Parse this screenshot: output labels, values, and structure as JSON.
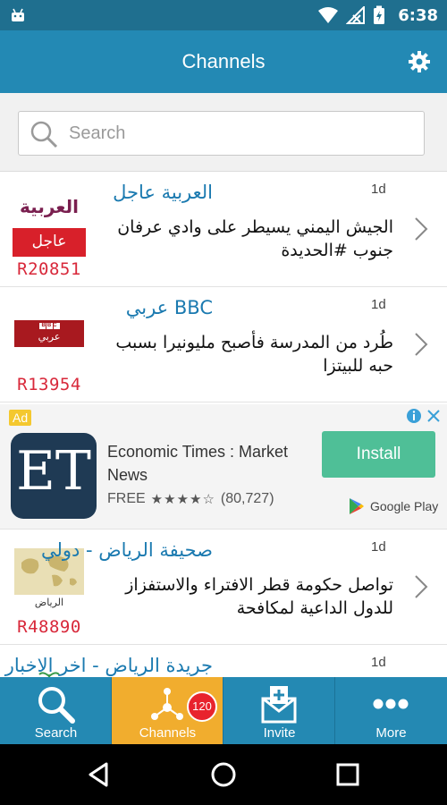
{
  "status_bar": {
    "time": "6:38"
  },
  "app_bar": {
    "title": "Channels",
    "settings_icon": "gear-icon"
  },
  "search": {
    "placeholder": "Search"
  },
  "channels": [
    {
      "name": "العربية عاجل",
      "age": "1d",
      "headline": "الجيش اليمني يسيطر على وادي عرفان جنوب #الحديدة",
      "count": "R20851",
      "logo": {
        "line1": "العربية",
        "line2": "عاجل"
      }
    },
    {
      "name": "BBC عربي",
      "age": "1d",
      "headline": "طُرد من المدرسة فأصبح مليونيرا بسبب حبه للبيتزا",
      "count": "R13954",
      "logo": {
        "line1": "BBC",
        "line2": "عربي"
      }
    },
    {
      "name": "صحيفة الرياض - دولي",
      "age": "1d",
      "headline": "تواصل حكومة قطر الافتراء والاستفزاز للدول الداعية لمكافحة",
      "count": "R48890",
      "logo": {
        "line1": "الرياض"
      }
    },
    {
      "name": "جريدة الرياض - اخر الاخبار الا...",
      "age": "1d",
      "headline": "",
      "count": ""
    }
  ],
  "ad": {
    "badge": "Ad",
    "logo_text": "ET",
    "title": "Economic Times : Market News",
    "price": "FREE",
    "stars": "★★★★☆",
    "rating_count": "(80,727)",
    "install_label": "Install",
    "store_label": "Google Play"
  },
  "bottom_nav": [
    {
      "label": "Search",
      "icon": "search-icon"
    },
    {
      "label": "Channels",
      "icon": "channels-icon",
      "badge": "120",
      "active": true
    },
    {
      "label": "Invite",
      "icon": "invite-icon"
    },
    {
      "label": "More",
      "icon": "more-icon"
    }
  ],
  "colors": {
    "status_bar": "#1f6f8f",
    "app_bar": "#2389b4",
    "active_tab": "#f1ad2e",
    "count_red": "#d8283a",
    "channel_name_blue": "#1b7ab0",
    "install_green": "#4fbf97"
  }
}
